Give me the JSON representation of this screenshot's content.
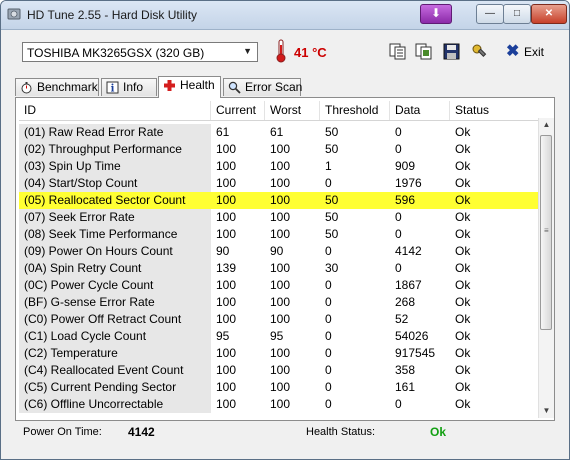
{
  "window": {
    "title": "HD Tune 2.55 - Hard Disk Utility"
  },
  "toolbar": {
    "drive": "TOSHIBA MK3265GSX (320 GB)",
    "temperature": "41 °C",
    "exit_label": "Exit",
    "exit_label_underline": "E"
  },
  "tabs": [
    {
      "label": "Benchmark",
      "icon": "stopwatch-icon"
    },
    {
      "label": "Info",
      "icon": "info-icon"
    },
    {
      "label": "Health",
      "icon": "health-cross-icon",
      "active": true
    },
    {
      "label": "Error Scan",
      "icon": "magnifier-icon"
    }
  ],
  "table": {
    "columns": [
      "ID",
      "Current",
      "Worst",
      "Threshold",
      "Data",
      "Status"
    ],
    "rows": [
      {
        "id": "(01) Raw Read Error Rate",
        "current": "61",
        "worst": "61",
        "threshold": "50",
        "data": "0",
        "status": "Ok"
      },
      {
        "id": "(02) Throughput Performance",
        "current": "100",
        "worst": "100",
        "threshold": "50",
        "data": "0",
        "status": "Ok"
      },
      {
        "id": "(03) Spin Up Time",
        "current": "100",
        "worst": "100",
        "threshold": "1",
        "data": "909",
        "status": "Ok"
      },
      {
        "id": "(04) Start/Stop Count",
        "current": "100",
        "worst": "100",
        "threshold": "0",
        "data": "1976",
        "status": "Ok"
      },
      {
        "id": "(05) Reallocated Sector Count",
        "current": "100",
        "worst": "100",
        "threshold": "50",
        "data": "596",
        "status": "Ok",
        "highlighted": true
      },
      {
        "id": "(07) Seek Error Rate",
        "current": "100",
        "worst": "100",
        "threshold": "50",
        "data": "0",
        "status": "Ok"
      },
      {
        "id": "(08) Seek Time Performance",
        "current": "100",
        "worst": "100",
        "threshold": "50",
        "data": "0",
        "status": "Ok"
      },
      {
        "id": "(09) Power On Hours Count",
        "current": "90",
        "worst": "90",
        "threshold": "0",
        "data": "4142",
        "status": "Ok"
      },
      {
        "id": "(0A) Spin Retry Count",
        "current": "139",
        "worst": "100",
        "threshold": "30",
        "data": "0",
        "status": "Ok"
      },
      {
        "id": "(0C) Power Cycle Count",
        "current": "100",
        "worst": "100",
        "threshold": "0",
        "data": "1867",
        "status": "Ok"
      },
      {
        "id": "(BF) G-sense Error Rate",
        "current": "100",
        "worst": "100",
        "threshold": "0",
        "data": "268",
        "status": "Ok"
      },
      {
        "id": "(C0) Power Off Retract Count",
        "current": "100",
        "worst": "100",
        "threshold": "0",
        "data": "52",
        "status": "Ok"
      },
      {
        "id": "(C1) Load Cycle Count",
        "current": "95",
        "worst": "95",
        "threshold": "0",
        "data": "54026",
        "status": "Ok"
      },
      {
        "id": "(C2) Temperature",
        "current": "100",
        "worst": "100",
        "threshold": "0",
        "data": "917545",
        "status": "Ok"
      },
      {
        "id": "(C4) Reallocated Event Count",
        "current": "100",
        "worst": "100",
        "threshold": "0",
        "data": "358",
        "status": "Ok"
      },
      {
        "id": "(C5) Current Pending Sector",
        "current": "100",
        "worst": "100",
        "threshold": "0",
        "data": "161",
        "status": "Ok"
      },
      {
        "id": "(C6) Offline Uncorrectable",
        "current": "100",
        "worst": "100",
        "threshold": "0",
        "data": "0",
        "status": "Ok"
      }
    ]
  },
  "status_bar": {
    "power_on_label": "Power On Time:",
    "power_on_value": "4142",
    "health_label": "Health Status:",
    "health_value": "Ok"
  },
  "colors": {
    "highlight": "#ffff33",
    "temperature": "#cc0000",
    "health_ok": "#12a012"
  }
}
